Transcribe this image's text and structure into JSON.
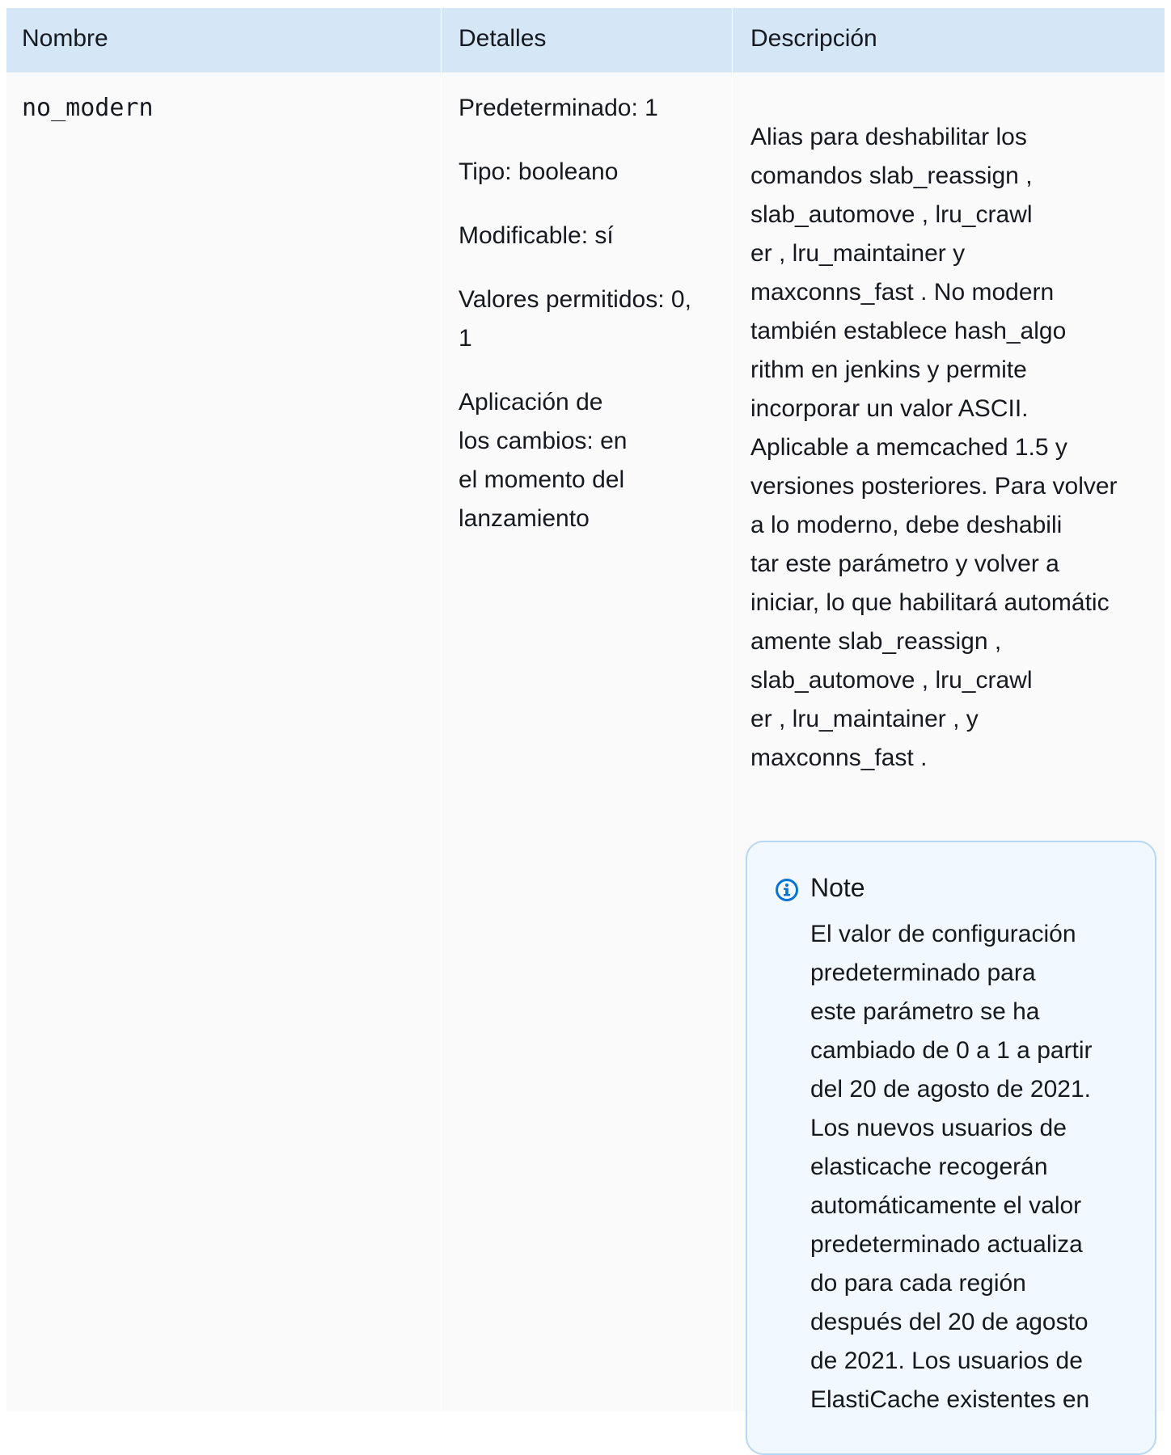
{
  "table": {
    "headers": [
      "Nombre",
      "Detalles",
      "Descripción"
    ],
    "row": {
      "name": "no_modern",
      "details": [
        "Predeterminado: 1",
        "Tipo: booleano",
        "Modificable: sí",
        "Valores permitidos: 0,",
        "1",
        "Aplicación de",
        "los cambios: en",
        "el momento del",
        "lanzamiento"
      ],
      "description_lines": [
        "Alias para deshabilitar los",
        "comandos slab_reassign ,",
        "slab_automove , lru_crawl",
        "er , lru_maintainer y",
        "maxconns_fast . No modern",
        "también establece hash_algo",
        "rithm en jenkins y permite",
        "incorporar un valor ASCII.",
        "Aplicable a memcached 1.5 y",
        "versiones posteriores. Para volver",
        "a lo moderno, debe deshabili",
        "tar este parámetro y volver a",
        "iniciar, lo que habilitará automátic",
        "amente slab_reassign ,",
        "slab_automove , lru_crawl",
        "er , lru_maintainer , y",
        "maxconns_fast ."
      ],
      "note": {
        "icon": "info-icon",
        "title": "Note",
        "lines": [
          "El valor de configuración",
          "predeterminado para",
          "este parámetro se ha",
          "cambiado de 0 a 1 a partir",
          "del 20 de agosto de 2021.",
          "Los nuevos usuarios de",
          "elasticache recogerán",
          "automáticamente el valor",
          "predeterminado actualiza",
          "do para cada región",
          "después del 20 de agosto",
          "de 2021. Los usuarios de",
          "ElastiCache existentes en"
        ]
      }
    }
  },
  "colors": {
    "header_bg": "#d5e6f7",
    "table_bg": "#fafafa",
    "note_border": "#b8d7f4",
    "note_bg": "#f1f8ff",
    "info_icon": "#0972d3"
  }
}
